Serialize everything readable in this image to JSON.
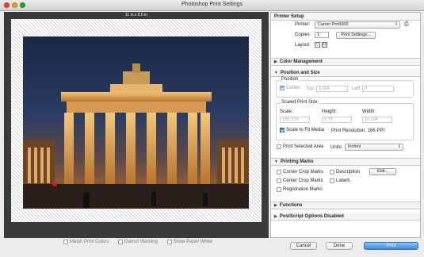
{
  "window": {
    "title": "Photoshop Print Settings"
  },
  "preview": {
    "size_label": "11 in x 8.5 in",
    "bottom_checks": [
      {
        "label": "Match Print Colors",
        "checked": false
      },
      {
        "label": "Gamut Warning",
        "checked": false
      },
      {
        "label": "Show Paper White",
        "checked": false
      }
    ]
  },
  "printer_setup": {
    "header": "Printer Setup",
    "printer_label": "Printer:",
    "printer_value": "Canon Pro9000",
    "copies_label": "Copies:",
    "copies_value": "1",
    "print_settings_button": "Print Settings...",
    "layout_label": "Layout:"
  },
  "color_management": {
    "header": "Color Management"
  },
  "position_size": {
    "header": "Position and Size",
    "position_title": "Position",
    "center_label": "Center",
    "center_checked": true,
    "top_label": "Top:",
    "top_value": "0.604",
    "left_label": "Left:",
    "left_value": "0",
    "scaled_title": "Scaled Print Size",
    "scale_label": "Scale:",
    "scale_value": "180.11%",
    "height_label": "Height:",
    "height_value": "6.79",
    "width_label": "Width:",
    "width_value": "10.194",
    "fit_media_label": "Scale to Fit Media",
    "fit_media_checked": true,
    "resolution_text": "Print Resolution: 166 PPI",
    "print_selected_label": "Print Selected Area",
    "print_selected_checked": false,
    "units_label": "Units:",
    "units_value": "Inches"
  },
  "printing_marks": {
    "header": "Printing Marks",
    "corner_crop": "Corner Crop Marks",
    "center_crop": "Center Crop Marks",
    "registration": "Registration Marks",
    "description": "Description",
    "labels": "Labels",
    "edit_button": "Edit..."
  },
  "functions": {
    "header": "Functions"
  },
  "postscript": {
    "header": "PostScript Options Disabled"
  },
  "footer": {
    "cancel": "Cancel",
    "done": "Done",
    "print": "Print"
  },
  "icons": {
    "printer": "printer-icon",
    "portrait": "portrait-layout-icon",
    "landscape": "landscape-layout-icon"
  },
  "colors": {
    "primary_button": "#3b8be6",
    "checkbox_checked": "#2f7fe0"
  }
}
